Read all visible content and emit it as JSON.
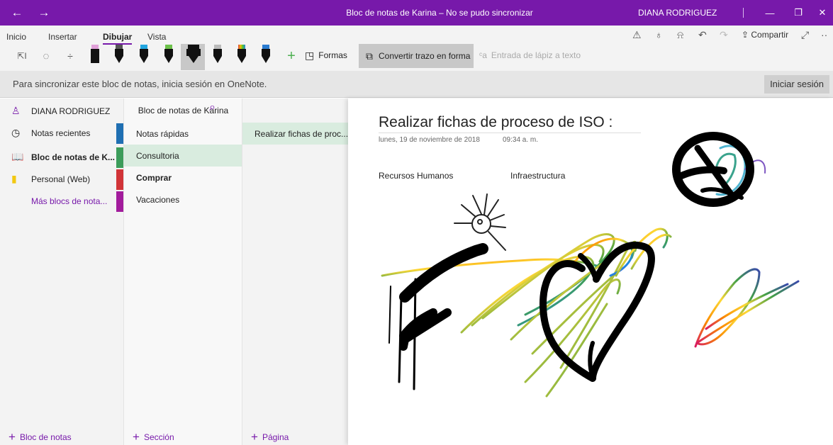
{
  "window": {
    "title": "Bloc de notas de Karina – No se pudo sincronizar",
    "user": "DIANA RODRIGUEZ",
    "colors": {
      "brand": "#7719aa",
      "selected": "#d9ecdf"
    }
  },
  "ribbon": {
    "tabs": [
      "Inicio",
      "Insertar",
      "Dibujar",
      "Vista"
    ],
    "active_tab": "Dibujar",
    "share_label": "Compartir",
    "formas_label": "Formas",
    "convert_label": "Convertir trazo en forma",
    "lapiz_label": "Entrada de lápiz a texto",
    "pens": [
      {
        "name": "pink-highlighter",
        "color": "#e0a0d8"
      },
      {
        "name": "black-pen",
        "color": "#111111"
      },
      {
        "name": "cyan-pen",
        "color": "#23a6e0"
      },
      {
        "name": "green-pen",
        "color": "#6cc04a"
      },
      {
        "name": "yellow-highlighter-selected",
        "color": "#111111"
      },
      {
        "name": "galaxy-pen",
        "color": "#666666"
      },
      {
        "name": "rainbow-pen",
        "color": "#e04040"
      },
      {
        "name": "ocean-pen",
        "color": "#2a7bd0"
      }
    ]
  },
  "infobar": {
    "message": "Para sincronizar este bloc de notas, inicia sesión en OneNote.",
    "signin_label": "Iniciar sesión"
  },
  "notebooks": {
    "user": "DIANA RODRIGUEZ",
    "items": [
      {
        "label": "Notas recientes",
        "icon": "clock-icon"
      },
      {
        "label": "Bloc de notas de K...",
        "icon": "notebook-icon"
      },
      {
        "label": "Personal (Web)",
        "icon": "notebook-yellow-icon"
      },
      {
        "label": "Más blocs de nota..."
      }
    ],
    "add_label": "Bloc de notas"
  },
  "sections": {
    "header": "Bloc de notas de Karina",
    "items": [
      {
        "label": "Notas rápidas",
        "color": "#1f6fb2"
      },
      {
        "label": "Consultoria",
        "color": "#3c9c5a"
      },
      {
        "label": "Comprar",
        "color": "#d13438"
      },
      {
        "label": "Vacaciones",
        "color": "#a21c9c"
      }
    ],
    "add_label": "Sección"
  },
  "pages": {
    "items": [
      "Realizar fichas de proc..."
    ],
    "add_label": "Página"
  },
  "page": {
    "title": "Realizar fichas de proceso de ISO :",
    "date": "lunes, 19 de noviembre de 2018",
    "time": "09:34 a. m.",
    "notes": [
      "Recursos Humanos",
      "Infraestructura"
    ]
  }
}
